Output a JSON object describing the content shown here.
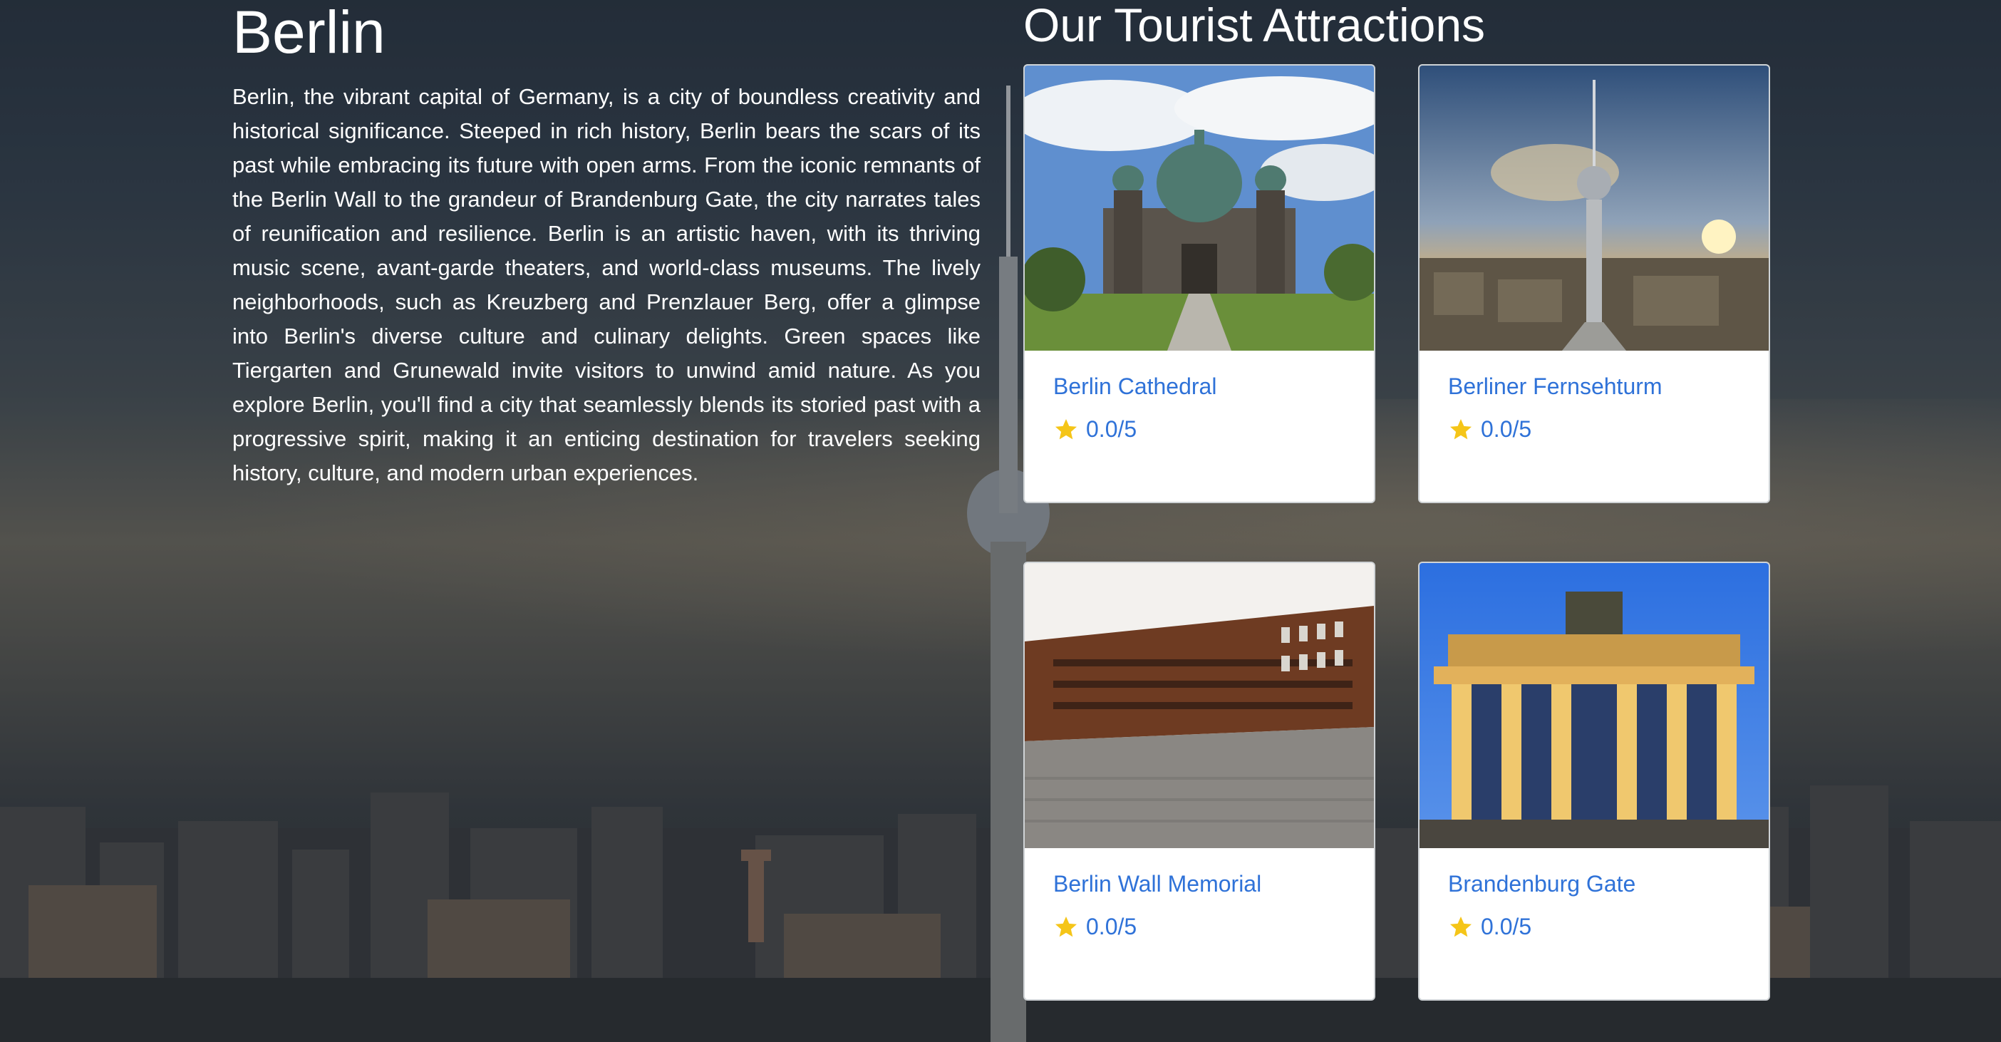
{
  "city": {
    "name": "Berlin",
    "description": "Berlin, the vibrant capital of Germany, is a city of boundless creativity and historical significance. Steeped in rich history, Berlin bears the scars of its past while embracing its future with open arms. From the iconic remnants of the Berlin Wall to the grandeur of Brandenburg Gate, the city narrates tales of reunification and resilience. Berlin is an artistic haven, with its thriving music scene, avant-garde theaters, and world-class museums. The lively neighborhoods, such as Kreuzberg and Prenzlauer Berg, offer a glimpse into Berlin's diverse culture and culinary delights. Green spaces like Tiergarten and Grunewald invite visitors to unwind amid nature. As you explore Berlin, you'll find a city that seamlessly blends its storied past with a progressive spirit, making it an enticing destination for travelers seeking history, culture, and modern urban experiences."
  },
  "attractions": {
    "heading": "Our Tourist Attractions",
    "items": [
      {
        "name": "Berlin Cathedral",
        "rating": "0.0/5",
        "icon": "star-icon"
      },
      {
        "name": "Berliner Fernsehturm",
        "rating": "0.0/5",
        "icon": "star-icon"
      },
      {
        "name": "Berlin Wall Memorial",
        "rating": "0.0/5",
        "icon": "star-icon"
      },
      {
        "name": "Brandenburg Gate",
        "rating": "0.0/5",
        "icon": "star-icon"
      }
    ]
  },
  "colors": {
    "link": "#2f72d8",
    "star": "#f5c518",
    "card_border": "#cfd3d6"
  }
}
